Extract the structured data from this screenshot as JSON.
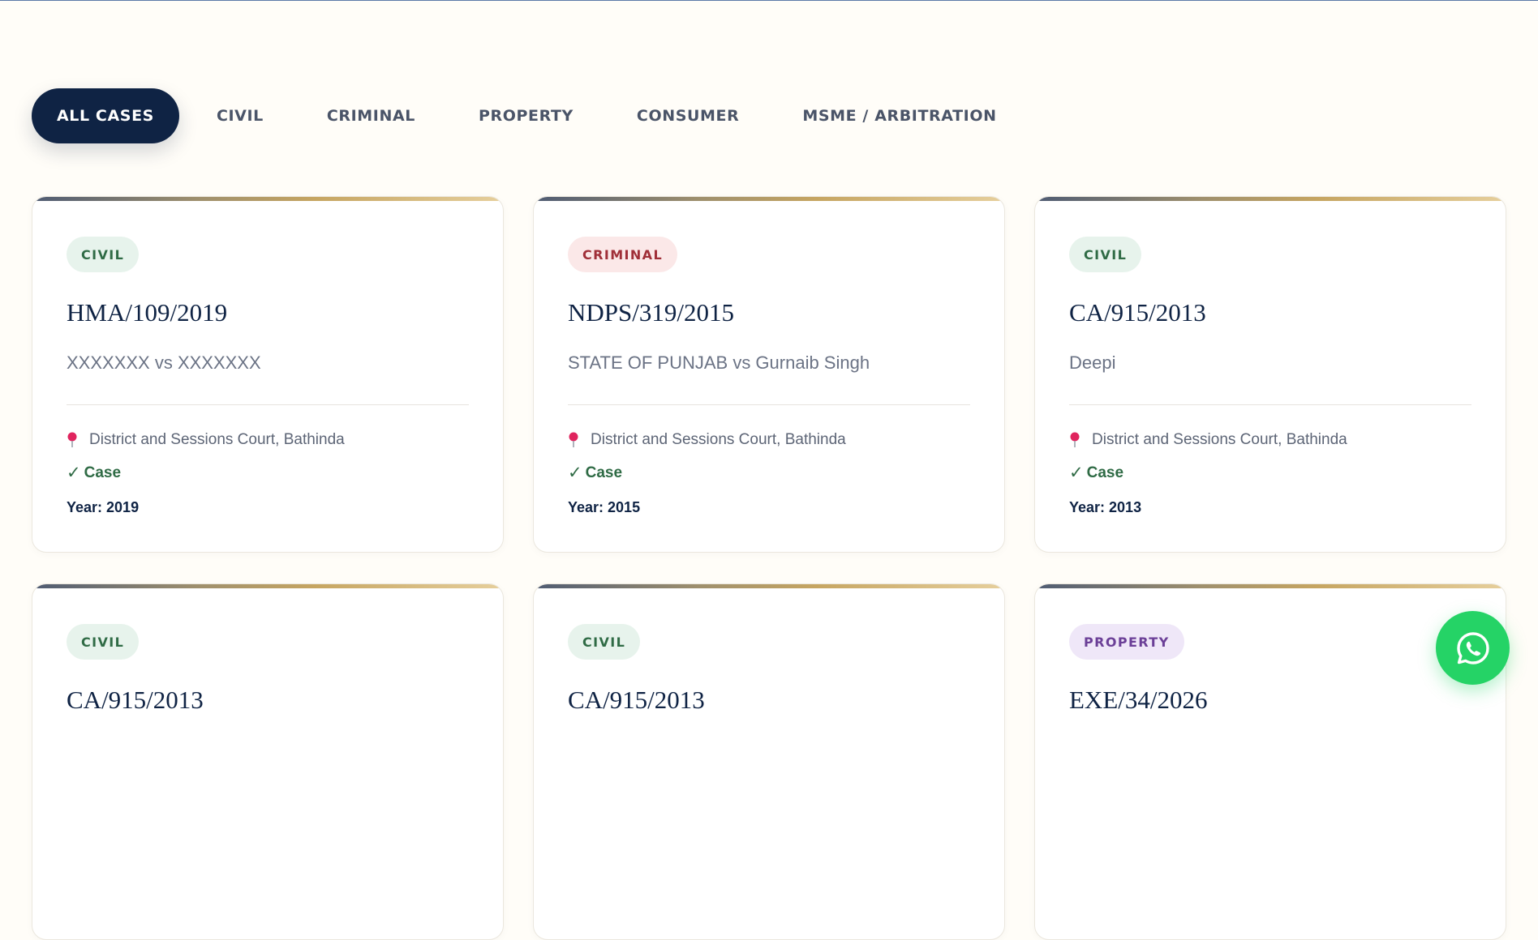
{
  "filters": {
    "tabs": [
      {
        "label": "ALL CASES",
        "active": true
      },
      {
        "label": "CIVIL"
      },
      {
        "label": "CRIMINAL"
      },
      {
        "label": "PROPERTY"
      },
      {
        "label": "CONSUMER"
      },
      {
        "label": "MSME / ARBITRATION"
      }
    ]
  },
  "cases": [
    {
      "category": "CIVIL",
      "case_no": "HMA/109/2019",
      "parties": "XXXXXXX vs XXXXXXX",
      "court": "District and Sessions Court, Bathinda",
      "status": "Case",
      "year": "Year: 2019"
    },
    {
      "category": "CRIMINAL",
      "case_no": "NDPS/319/2015",
      "parties": "STATE OF PUNJAB vs Gurnaib Singh",
      "court": "District and Sessions Court, Bathinda",
      "status": "Case",
      "year": "Year: 2015"
    },
    {
      "category": "CIVIL",
      "case_no": "CA/915/2013",
      "parties": "Deepi",
      "court": "District and Sessions Court, Bathinda",
      "status": "Case",
      "year": "Year: 2013"
    },
    {
      "category": "CIVIL",
      "case_no": "CA/915/2013"
    },
    {
      "category": "CIVIL",
      "case_no": "CA/915/2013"
    },
    {
      "category": "PROPERTY",
      "case_no": "EXE/34/2026"
    }
  ],
  "icons": {
    "location": "pin-icon",
    "status": "check-icon",
    "chat": "whatsapp-icon"
  },
  "colors": {
    "navy": "#0f2344",
    "civil_badge": "#2f6b45",
    "criminal_badge": "#a02f38",
    "property_badge": "#6b3f97",
    "whatsapp": "#25d366",
    "accent_gold": "#c6a561"
  }
}
